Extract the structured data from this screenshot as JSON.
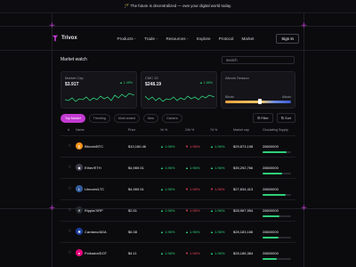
{
  "banner": {
    "text": "🪄 The future is decentralized — own your digital world today."
  },
  "nav": {
    "logo": "Trivox",
    "menu": [
      "Products",
      "Trade",
      "Resources",
      "Explore",
      "Protocol",
      "Market"
    ],
    "signin": "Sign In"
  },
  "market": {
    "title": "Market watch",
    "search_placeholder": "search"
  },
  "cards": [
    {
      "label": "Market Cap",
      "value": "$3.91T",
      "change": "▲ 1.49%"
    },
    {
      "label": "CMC 20",
      "value": "$248.19",
      "change": "▲ 1.66%"
    },
    {
      "label": "Altcoin Season",
      "value": "",
      "left": "Bitcoin",
      "right": "Altcoin",
      "level": 0.52
    }
  ],
  "tabs": [
    "Top Market",
    "Trending",
    "Most visited",
    "New",
    "Gainers"
  ],
  "tools": {
    "filter": "Filter",
    "sort": "Sort"
  },
  "table": {
    "headers": [
      "#",
      "Name",
      "Price",
      "1h %",
      "24h %",
      "7d %",
      "Market cap",
      "Circulating Supply"
    ],
    "rows": [
      {
        "name": "Bitcoin/BTC",
        "price": "$10,160.46",
        "h1": "▲ 1.96%",
        "h24": "▼ 1.96%",
        "d7": "▲ 1.96%",
        "cap": "$29,873,198",
        "supply": "28600000",
        "fill": 0.85,
        "color": "#f7931a",
        "glyph": "₿",
        "signs": [
          "pos",
          "neg",
          "pos"
        ]
      },
      {
        "name": "Ether/ETH",
        "price": "$4,969.51",
        "h1": "▲ 1.96%",
        "h24": "▲ 1.96%",
        "d7": "▲ 1.96%",
        "cap": "$35,292,766",
        "supply": "28600000",
        "fill": 0.7,
        "color": "#3c3c4a",
        "glyph": "◆",
        "signs": [
          "pos",
          "pos",
          "pos"
        ]
      },
      {
        "name": "Litecoin/LTC",
        "price": "$4,969.51",
        "h1": "▲ 1.96%",
        "h24": "▼ 1.96%",
        "d7": "▼ 1.96%",
        "cap": "$27,634,413",
        "supply": "28600000",
        "fill": 0.8,
        "color": "#345d9d",
        "glyph": "Ł",
        "signs": [
          "pos",
          "neg",
          "neg"
        ]
      },
      {
        "name": "Ripple/XRP",
        "price": "$2.51",
        "h1": "▲ 1.96%",
        "h24": "▼ 1.96%",
        "d7": "▲ 1.96%",
        "cap": "$28,987,954",
        "supply": "28600000",
        "fill": 0.6,
        "color": "#23292f",
        "glyph": "✕",
        "signs": [
          "pos",
          "neg",
          "pos"
        ]
      },
      {
        "name": "Cardano/ADA",
        "price": "$6.38",
        "h1": "▲ 1.96%",
        "h24": "▲ 1.96%",
        "d7": "▲ 1.96%",
        "cap": "$28,183,166",
        "supply": "28600000",
        "fill": 0.55,
        "color": "#1c3f9c",
        "glyph": "✺",
        "signs": [
          "pos",
          "pos",
          "pos"
        ]
      },
      {
        "name": "Polkadot/DOT",
        "price": "$4.11",
        "h1": "▲ 1.96%",
        "h24": "▼ 1.96%",
        "d7": "▲ 1.96%",
        "cap": "$28,186,384",
        "supply": "28600000",
        "fill": 0.5,
        "color": "#e6007a",
        "glyph": "●",
        "signs": [
          "pos",
          "neg",
          "pos"
        ]
      }
    ]
  },
  "colors": {
    "accent": "#c23ad1",
    "positive": "#2fd07a",
    "negative": "#f0455a"
  }
}
